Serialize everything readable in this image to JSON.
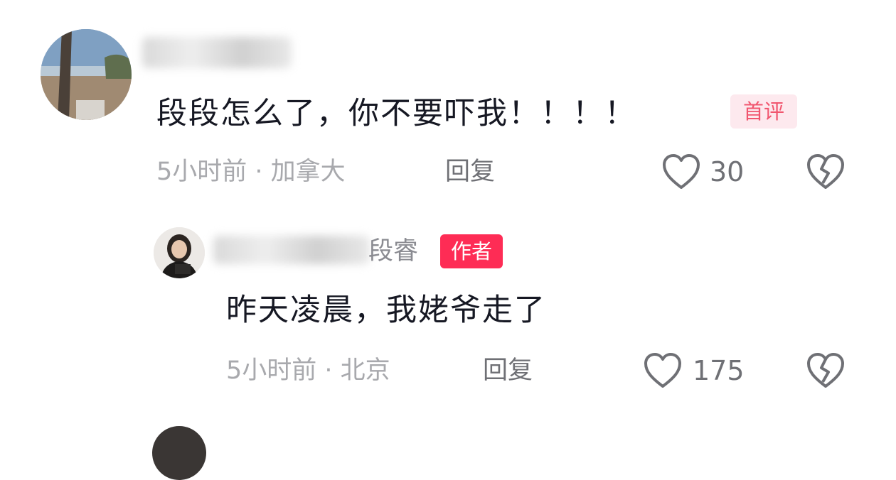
{
  "comment": {
    "text": "段段怎么了，你不要吓我！！！！",
    "badge": "首评",
    "time_location": "5小时前 · 加拿大",
    "reply_label": "回复",
    "like_count": "30"
  },
  "reply": {
    "author_name": "段睿",
    "author_badge": "作者",
    "text": "昨天凌晨，我姥爷走了",
    "time_location": "5小时前 · 北京",
    "reply_label": "回复",
    "like_count": "175"
  },
  "icons": {
    "like": "heart-outline-icon",
    "dislike": "broken-heart-icon"
  }
}
